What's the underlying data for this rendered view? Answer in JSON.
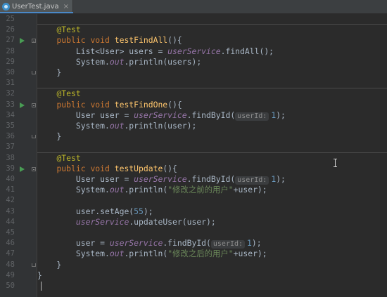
{
  "tab": {
    "title": "UserTest.java",
    "close": "×",
    "icon": "java-class-icon"
  },
  "colors": {
    "keyword": "#cc7832",
    "annotation": "#bbb529",
    "method": "#ffc66d",
    "field": "#9876aa",
    "string": "#6a8759",
    "number": "#6897bb",
    "text": "#a9b7c6",
    "background": "#2b2b2b",
    "gutter": "#313335"
  },
  "editor": {
    "line_numbers": [
      "25",
      "26",
      "27",
      "28",
      "29",
      "30",
      "31",
      "32",
      "33",
      "34",
      "35",
      "36",
      "37",
      "38",
      "39",
      "40",
      "41",
      "42",
      "43",
      "44",
      "45",
      "46",
      "47",
      "48",
      "49",
      "50"
    ],
    "run_markers": [
      "27",
      "33",
      "39"
    ],
    "lines": [
      {
        "n": "25",
        "parts": []
      },
      {
        "n": "26",
        "parts": [
          {
            "t": "    ",
            "c": "var"
          },
          {
            "t": "@Test",
            "c": "ann"
          }
        ]
      },
      {
        "n": "27",
        "parts": [
          {
            "t": "    ",
            "c": "var"
          },
          {
            "t": "public void ",
            "c": "kw"
          },
          {
            "t": "testFindAll",
            "c": "fn"
          },
          {
            "t": "(){",
            "c": "var"
          }
        ]
      },
      {
        "n": "28",
        "parts": [
          {
            "t": "        List<User> users = ",
            "c": "var"
          },
          {
            "t": "userService",
            "c": "field"
          },
          {
            "t": ".findAll();",
            "c": "var"
          }
        ]
      },
      {
        "n": "29",
        "parts": [
          {
            "t": "        System.",
            "c": "var"
          },
          {
            "t": "out",
            "c": "field"
          },
          {
            "t": ".println(users);",
            "c": "var"
          }
        ]
      },
      {
        "n": "30",
        "parts": [
          {
            "t": "    }",
            "c": "var"
          }
        ]
      },
      {
        "n": "31",
        "parts": []
      },
      {
        "n": "32",
        "parts": [
          {
            "t": "    ",
            "c": "var"
          },
          {
            "t": "@Test",
            "c": "ann"
          }
        ]
      },
      {
        "n": "33",
        "parts": [
          {
            "t": "    ",
            "c": "var"
          },
          {
            "t": "public void ",
            "c": "kw"
          },
          {
            "t": "testFindOne",
            "c": "fn"
          },
          {
            "t": "(){",
            "c": "var"
          }
        ]
      },
      {
        "n": "34",
        "parts": [
          {
            "t": "        User user = ",
            "c": "var"
          },
          {
            "t": "userService",
            "c": "field"
          },
          {
            "t": ".findById(",
            "c": "var"
          },
          {
            "t": "userId:",
            "c": "hint"
          },
          {
            "t": "1",
            "c": "num"
          },
          {
            "t": ");",
            "c": "var"
          }
        ]
      },
      {
        "n": "35",
        "parts": [
          {
            "t": "        System.",
            "c": "var"
          },
          {
            "t": "out",
            "c": "field"
          },
          {
            "t": ".println(user);",
            "c": "var"
          }
        ]
      },
      {
        "n": "36",
        "parts": [
          {
            "t": "    }",
            "c": "var"
          }
        ]
      },
      {
        "n": "37",
        "parts": []
      },
      {
        "n": "38",
        "parts": [
          {
            "t": "    ",
            "c": "var"
          },
          {
            "t": "@Test",
            "c": "ann"
          }
        ]
      },
      {
        "n": "39",
        "parts": [
          {
            "t": "    ",
            "c": "var"
          },
          {
            "t": "public void ",
            "c": "kw"
          },
          {
            "t": "testUpdate",
            "c": "fn"
          },
          {
            "t": "(){",
            "c": "var"
          }
        ]
      },
      {
        "n": "40",
        "parts": [
          {
            "t": "        User user = ",
            "c": "var"
          },
          {
            "t": "userService",
            "c": "field"
          },
          {
            "t": ".findById(",
            "c": "var"
          },
          {
            "t": "userId:",
            "c": "hint"
          },
          {
            "t": "1",
            "c": "num"
          },
          {
            "t": ");",
            "c": "var"
          }
        ]
      },
      {
        "n": "41",
        "parts": [
          {
            "t": "        System.",
            "c": "var"
          },
          {
            "t": "out",
            "c": "field"
          },
          {
            "t": ".println(",
            "c": "var"
          },
          {
            "t": "\"修改之前的用户\"",
            "c": "str"
          },
          {
            "t": "+user);",
            "c": "var"
          }
        ]
      },
      {
        "n": "42",
        "parts": []
      },
      {
        "n": "43",
        "parts": [
          {
            "t": "        user.setAge(",
            "c": "var"
          },
          {
            "t": "55",
            "c": "num"
          },
          {
            "t": ");",
            "c": "var"
          }
        ]
      },
      {
        "n": "44",
        "parts": [
          {
            "t": "        ",
            "c": "var"
          },
          {
            "t": "userService",
            "c": "field"
          },
          {
            "t": ".updateUser(user);",
            "c": "var"
          }
        ]
      },
      {
        "n": "45",
        "parts": []
      },
      {
        "n": "46",
        "parts": [
          {
            "t": "        user = ",
            "c": "var"
          },
          {
            "t": "userService",
            "c": "field"
          },
          {
            "t": ".findById(",
            "c": "var"
          },
          {
            "t": "userId:",
            "c": "hint"
          },
          {
            "t": "1",
            "c": "num"
          },
          {
            "t": ");",
            "c": "var"
          }
        ]
      },
      {
        "n": "47",
        "parts": [
          {
            "t": "        System.",
            "c": "var"
          },
          {
            "t": "out",
            "c": "field"
          },
          {
            "t": ".println(",
            "c": "var"
          },
          {
            "t": "\"修改之后的用户\"",
            "c": "str"
          },
          {
            "t": "+user);",
            "c": "var"
          }
        ]
      },
      {
        "n": "48",
        "parts": [
          {
            "t": "    }",
            "c": "var"
          }
        ]
      },
      {
        "n": "49",
        "parts": [
          {
            "t": "}",
            "c": "var"
          }
        ]
      },
      {
        "n": "50",
        "parts": []
      }
    ]
  }
}
